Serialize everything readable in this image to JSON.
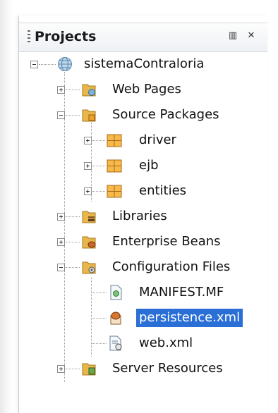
{
  "panel": {
    "title": "Projects",
    "minimize_glyph": "▥",
    "close_glyph": "✕"
  },
  "tree": {
    "root": {
      "label": "sistemaContraloria",
      "icon": "globe-project-icon"
    },
    "nodes": [
      {
        "label": "Web Pages",
        "icon": "folder-web-icon",
        "expanded": false
      },
      {
        "label": "Source Packages",
        "icon": "folder-source-icon",
        "expanded": true
      },
      {
        "label": "driver",
        "icon": "package-icon",
        "expanded": false
      },
      {
        "label": "ejb",
        "icon": "package-icon",
        "expanded": false
      },
      {
        "label": "entities",
        "icon": "package-icon",
        "expanded": false
      },
      {
        "label": "Libraries",
        "icon": "folder-libraries-icon",
        "expanded": false
      },
      {
        "label": "Enterprise Beans",
        "icon": "folder-beans-icon",
        "expanded": false
      },
      {
        "label": "Configuration Files",
        "icon": "folder-config-icon",
        "expanded": true
      },
      {
        "label": "MANIFEST.MF",
        "icon": "manifest-file-icon"
      },
      {
        "label": "persistence.xml",
        "icon": "persistence-file-icon",
        "selected": true
      },
      {
        "label": "web.xml",
        "icon": "xml-file-icon"
      },
      {
        "label": "Server Resources",
        "icon": "folder-server-icon",
        "expanded": false
      }
    ]
  },
  "colors": {
    "selection": "#2a6fd6",
    "folder": "#e8b64a",
    "package": "#f0a030"
  }
}
